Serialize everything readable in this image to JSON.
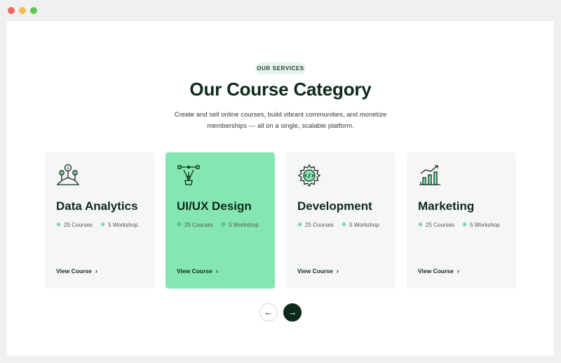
{
  "section": {
    "eyebrow": "OUR SERVICES",
    "heading": "Our Course Category",
    "description": "Create and sell online courses, build vibrant communities, and monetize memberships — all on a single, scalable platform."
  },
  "cards": [
    {
      "title": "Data Analytics",
      "courses": "25 Courses",
      "workshop": "5 Workshop",
      "link": "View Course",
      "icon": "pin-network-icon",
      "active": false
    },
    {
      "title": "UI/UX Design",
      "courses": "25 Courses",
      "workshop": "5 Workshop",
      "link": "View Course",
      "icon": "pen-tool-icon",
      "active": true
    },
    {
      "title": "Development",
      "courses": "25 Courses",
      "workshop": "5 Workshop",
      "link": "View Course",
      "icon": "code-gear-icon",
      "active": false
    },
    {
      "title": "Marketing",
      "courses": "25 Courses",
      "workshop": "5 Workshop",
      "link": "View Course",
      "icon": "growth-chart-icon",
      "active": false
    }
  ],
  "carousel": {
    "prev_icon": "arrow-left-icon",
    "next_icon": "arrow-right-icon"
  },
  "colors": {
    "accent": "#86e6b2",
    "dark": "#0f2a1a",
    "card_bg": "#f6f6f6"
  }
}
